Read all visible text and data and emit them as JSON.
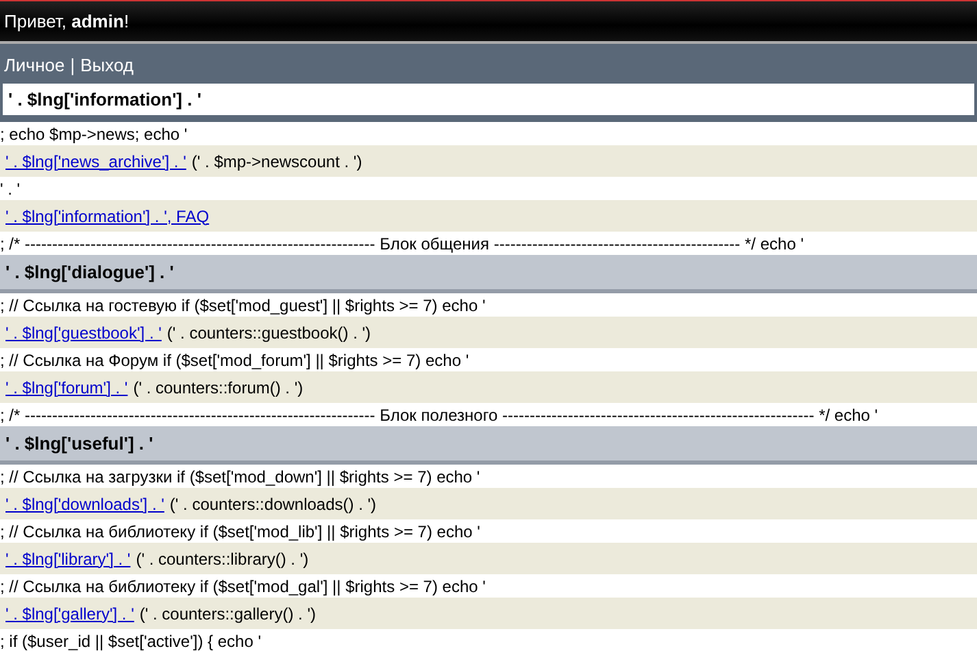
{
  "top_bar": {
    "greeting": "Привет, **admin**!"
  },
  "nav": {
    "links": [
      {
        "label": "Личное"
      },
      {
        "label": "Выход"
      }
    ],
    "separator": "|"
  },
  "sections": [
    {
      "kind": "boxed",
      "title": "' . $lng['information'] . '",
      "rows": [
        {
          "kind": "text",
          "text": "; echo $mp->news; echo '"
        },
        {
          "kind": "link",
          "link": "' . $lng['news_archive'] . '",
          "text": "(' . $mp->newscount . ')"
        },
        {
          "kind": "text",
          "text": "' . '"
        },
        {
          "kind": "link",
          "link": "' . $lng['information'] . ', FAQ"
        },
        {
          "kind": "text",
          "text": "; /* ---------------------------------------------------------------- Блок общения --------------------------------------------- */ echo '"
        }
      ]
    },
    {
      "kind": "bar",
      "title": "' . $lng['dialogue'] . '",
      "rows": [
        {
          "kind": "text",
          "text": "; // Ссылка на гостевую if ($set['mod_guest'] || $rights >= 7) echo '"
        },
        {
          "kind": "link",
          "link": "' . $lng['guestbook'] . '",
          "text": "(' . counters::guestbook() . ')"
        },
        {
          "kind": "text",
          "text": "; // Ссылка на Форум if ($set['mod_forum'] || $rights >= 7) echo '"
        },
        {
          "kind": "link",
          "link": "' . $lng['forum'] . '",
          "text": "(' . counters::forum() . ')"
        },
        {
          "kind": "text",
          "text": "; /* ---------------------------------------------------------------- Блок полезного --------------------------------------------------------- */ echo '"
        }
      ]
    },
    {
      "kind": "bar",
      "title": "' . $lng['useful'] . '",
      "rows": [
        {
          "kind": "text",
          "text": "; // Ссылка на загрузки if ($set['mod_down'] || $rights >= 7) echo '"
        },
        {
          "kind": "link",
          "link": "' . $lng['downloads'] . '",
          "text": "(' . counters::downloads() . ')"
        },
        {
          "kind": "text",
          "text": "; // Ссылка на библиотеку if ($set['mod_lib'] || $rights >= 7) echo '"
        },
        {
          "kind": "link",
          "link": "' . $lng['library'] . '",
          "text": "(' . counters::library() . ')"
        },
        {
          "kind": "text",
          "text": "; // Ссылка на библиотеку if ($set['mod_gal'] || $rights >= 7) echo '"
        },
        {
          "kind": "link",
          "link": "' . $lng['gallery'] . '",
          "text": "(' . counters::gallery() . ')"
        },
        {
          "kind": "text",
          "text": "; if ($user_id || $set['active']) { echo '"
        }
      ]
    }
  ]
}
